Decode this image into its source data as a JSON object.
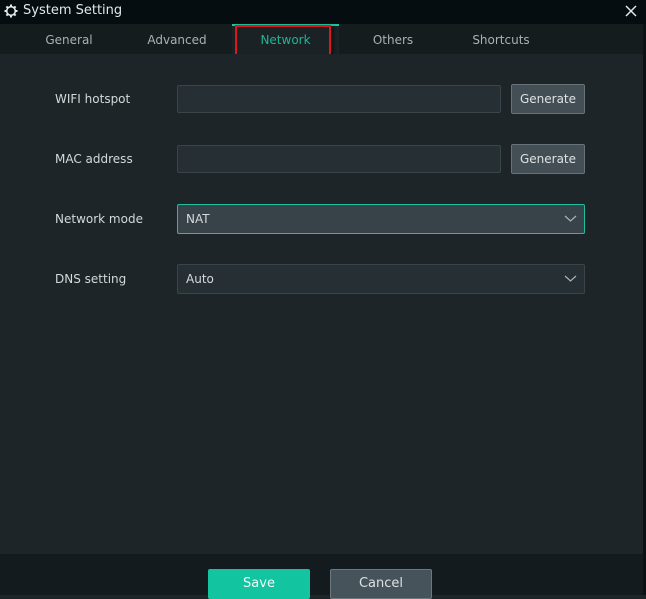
{
  "window": {
    "title": "System Setting",
    "icon": "gear-icon",
    "close_icon": "close-icon"
  },
  "tabs": [
    {
      "label": "General",
      "active": false
    },
    {
      "label": "Advanced",
      "active": false
    },
    {
      "label": "Network",
      "active": true
    },
    {
      "label": "Others",
      "active": false
    },
    {
      "label": "Shortcuts",
      "active": false
    }
  ],
  "form": {
    "wifi_hotspot": {
      "label": "WIFI hotspot",
      "value": "",
      "button": "Generate"
    },
    "mac_address": {
      "label": "MAC address",
      "value": "",
      "button": "Generate"
    },
    "network_mode": {
      "label": "Network mode",
      "selected": "NAT"
    },
    "dns_setting": {
      "label": "DNS setting",
      "selected": "Auto"
    }
  },
  "footer": {
    "save_label": "Save",
    "cancel_label": "Cancel"
  },
  "colors": {
    "accent": "#1ec3a0",
    "highlight_box": "#e0161e"
  }
}
